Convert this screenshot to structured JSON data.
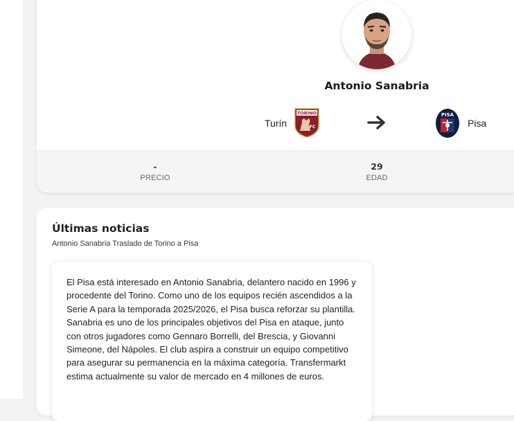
{
  "player": {
    "name": "Antonio Sanabria",
    "avatar_icon": "player-portrait-icon"
  },
  "transfer": {
    "from_club": "Turín",
    "from_crest_icon": "torino-crest-icon",
    "arrow_icon": "arrow-right-icon",
    "to_club": "Pisa",
    "to_crest_icon": "pisa-crest-icon"
  },
  "stats": [
    {
      "value": "-",
      "label": "PRECIO"
    },
    {
      "value": "29",
      "label": "EDAD"
    }
  ],
  "news": {
    "title": "Últimas noticias",
    "subtitle": "Antonio Sanabria Traslado de Torino a Pisa",
    "body": "El Pisa está interesado en Antonio Sanabria, delantero nacido en 1996 y procedente del Torino. Como uno de los equipos recién ascendidos a la Serie A para la temporada 2025/2026, el Pisa busca reforzar su plantilla. Sanabria es uno de los principales objetivos del Pisa en ataque, junto con otros jugadores como Gennaro Borrelli, del Brescia, y Giovanni Simeone, del Nápoles. El club aspira a construir un equipo competitivo para asegurar su permanencia en la máxima categoría. Transfermarkt estima actualmente su valor de mercado en 4 millones de euros."
  },
  "colors": {
    "torino_maroon": "#8b1e2b",
    "pisa_blue": "#1c3a73",
    "pisa_navy": "#0e1f3f",
    "pisa_red": "#c8202a",
    "arrow": "#333333"
  }
}
